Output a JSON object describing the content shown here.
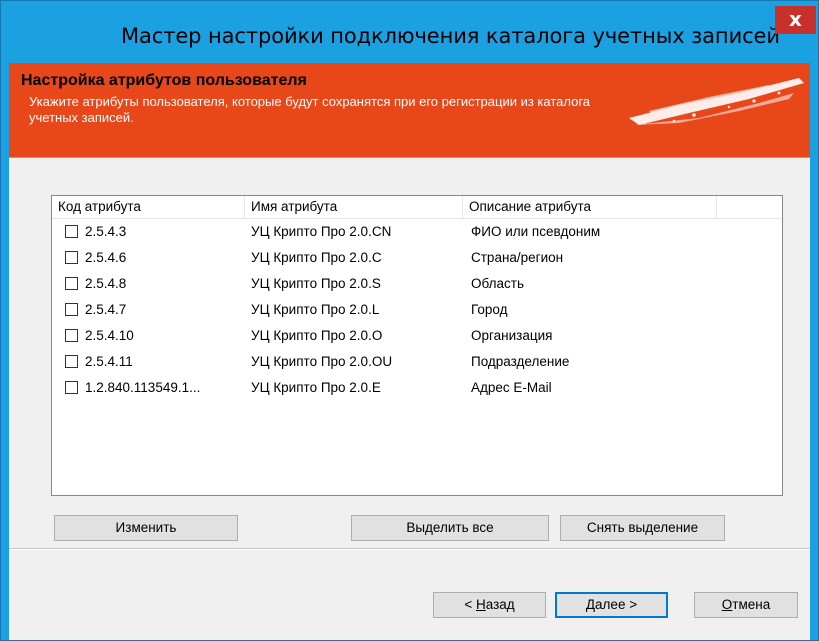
{
  "window": {
    "title": "Мастер настройки подключения каталога учетных записей",
    "close_glyph": "x"
  },
  "banner": {
    "title": "Настройка атрибутов пользователя",
    "subtitle": "Укажите атрибуты пользователя, которые будут сохранятся при его регистрации из каталога учетных записей."
  },
  "list": {
    "columns": [
      "Код атрибута",
      "Имя атрибута",
      "Описание атрибута"
    ],
    "rows": [
      {
        "code": "2.5.4.3",
        "name": "УЦ Крипто Про 2.0.CN",
        "desc": "ФИО или псевдоним",
        "checked": false
      },
      {
        "code": "2.5.4.6",
        "name": "УЦ Крипто Про 2.0.C",
        "desc": "Страна/регион",
        "checked": false
      },
      {
        "code": "2.5.4.8",
        "name": "УЦ Крипто Про 2.0.S",
        "desc": "Область",
        "checked": false
      },
      {
        "code": "2.5.4.7",
        "name": "УЦ Крипто Про 2.0.L",
        "desc": "Город",
        "checked": false
      },
      {
        "code": "2.5.4.10",
        "name": "УЦ Крипто Про 2.0.O",
        "desc": "Организация",
        "checked": false
      },
      {
        "code": "2.5.4.11",
        "name": "УЦ Крипто Про 2.0.OU",
        "desc": "Подразделение",
        "checked": false
      },
      {
        "code": "1.2.840.113549.1...",
        "name": "УЦ Крипто Про 2.0.E",
        "desc": "Адрес E-Mail",
        "checked": false
      }
    ]
  },
  "buttons": {
    "edit": "Изменить",
    "select_all": "Выделить все",
    "deselect": "Снять выделение",
    "back_prefix": "< ",
    "back_mnemonic": "Н",
    "back_rest": "азад",
    "next_mnemonic": "Д",
    "next_rest": "алее >",
    "cancel_mnemonic": "О",
    "cancel_rest": "тмена"
  },
  "colors": {
    "titlebar": "#1ba1e2",
    "banner": "#e8471a",
    "close": "#c7302b"
  }
}
